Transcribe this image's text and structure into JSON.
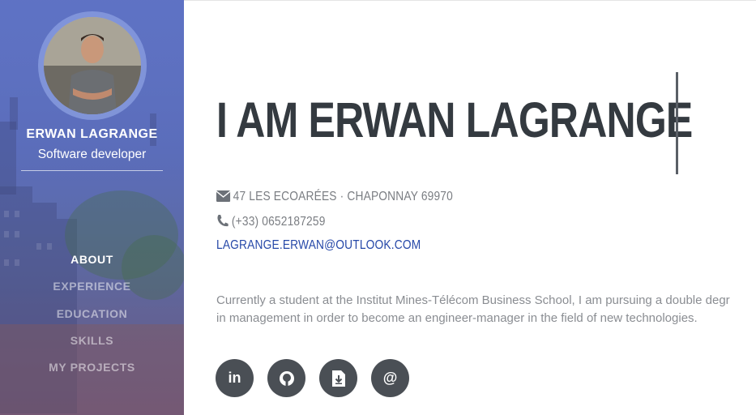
{
  "sidebar": {
    "name": "ERWAN LAGRANGE",
    "title": "Software developer",
    "nav": [
      {
        "label": "ABOUT"
      },
      {
        "label": "EXPERIENCE"
      },
      {
        "label": "EDUCATION"
      },
      {
        "label": "SKILLS"
      },
      {
        "label": "MY PROJECTS"
      }
    ],
    "active_item": "ABOUT"
  },
  "main": {
    "headline": "I AM ERWAN LAGRANGE",
    "address": "47 LES ECOARÉES · CHAPONNAY 69970",
    "phone": "(+33) 0652187259",
    "email": "LAGRANGE.ERWAN@OUTLOOK.COM",
    "bio_line1": "Currently a student at the Institut Mines-Télécom Business School, I am pursuing a double degr",
    "bio_line2": "in management in order to become an engineer-manager in the field of new technologies."
  },
  "socials": [
    {
      "icon": "linkedin-icon",
      "glyph": "in"
    },
    {
      "icon": "github-icon",
      "glyph": ""
    },
    {
      "icon": "resume-download-icon",
      "glyph": ""
    },
    {
      "icon": "at-icon",
      "glyph": "@"
    }
  ],
  "colors": {
    "sidebar_overlay": "#5c70c4",
    "heading": "#343a40",
    "link": "#2648a8",
    "muted": "#8a8d92",
    "social_bg": "#4a4f55"
  }
}
